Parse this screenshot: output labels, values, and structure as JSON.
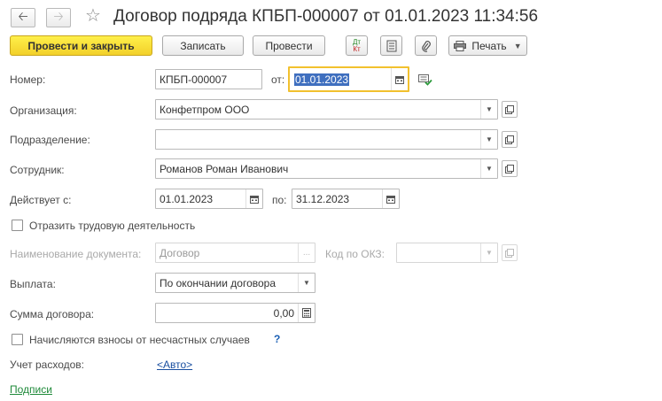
{
  "window": {
    "title": "Договор подряда КПБП-000007 от 01.01.2023 11:34:56"
  },
  "toolbar": {
    "post_and_close": "Провести и закрыть",
    "save": "Записать",
    "post": "Провести",
    "dt_kt_top": "Дт",
    "dt_kt_bottom": "Кт",
    "print": "Печать"
  },
  "form": {
    "number_label": "Номер:",
    "number_value": "КПБП-000007",
    "date_from_label": "от:",
    "date_value": "01.01.2023",
    "organization_label": "Организация:",
    "organization_value": "Конфетпром ООО",
    "division_label": "Подразделение:",
    "division_value": "",
    "employee_label": "Сотрудник:",
    "employee_value": "Романов Роман Иванович",
    "valid_from_label": "Действует с:",
    "valid_from_value": "01.01.2023",
    "valid_to_label": "по:",
    "valid_to_value": "31.12.2023",
    "labor_activity_label": "Отразить трудовую деятельность",
    "document_name_label": "Наименование документа:",
    "document_name_value": "Договор",
    "okz_label": "Код по ОКЗ:",
    "okz_value": "",
    "payment_label": "Выплата:",
    "payment_value": "По окончании договора",
    "contract_sum_label": "Сумма договора:",
    "contract_sum_value": "0,00",
    "accident_contrib_label": "Начисляются взносы от несчастных случаев",
    "help_mark": "?",
    "expense_label": "Учет расходов:",
    "expense_value": "<Авто>",
    "signatures_link": "Подписи"
  }
}
